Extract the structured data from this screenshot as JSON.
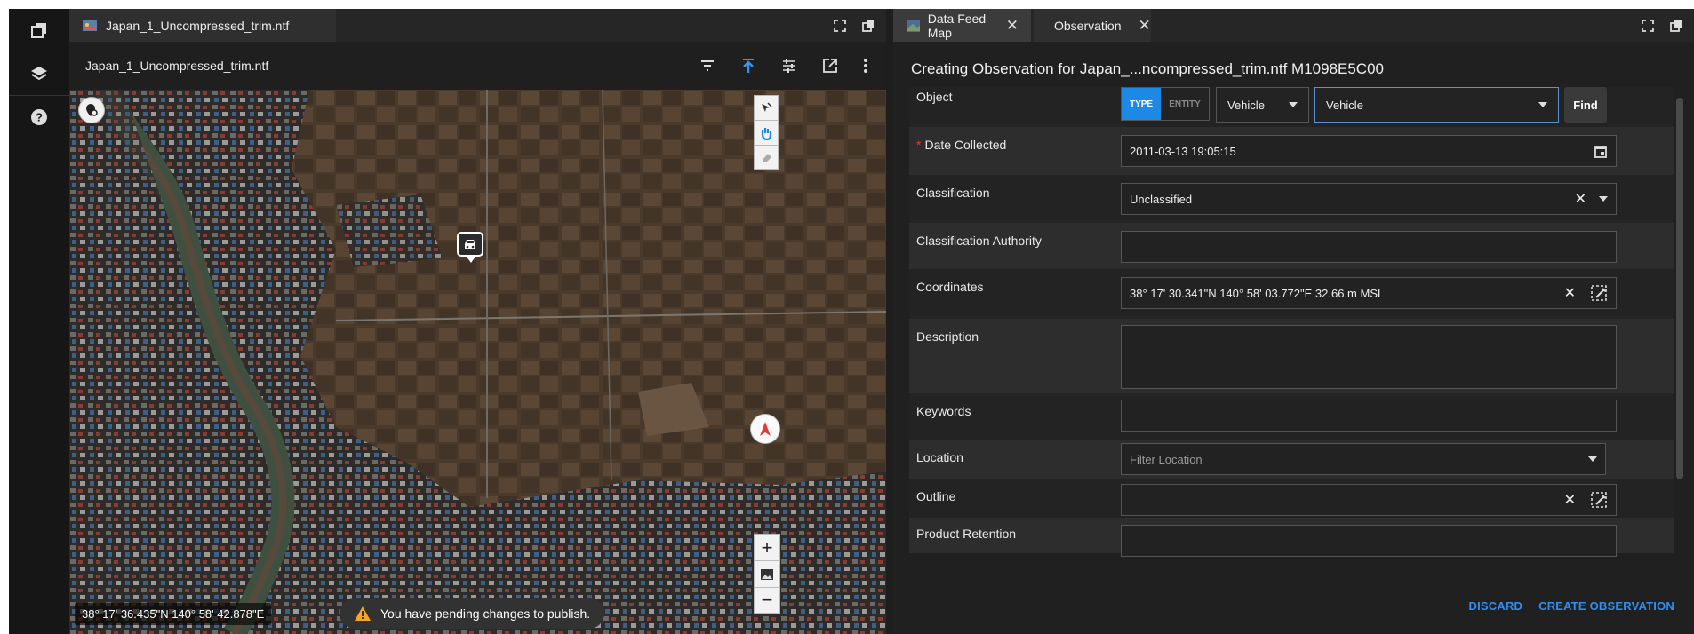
{
  "left_tab": {
    "title": "Japan_1_Uncompressed_trim.ntf"
  },
  "image_header": {
    "title": "Japan_1_Uncompressed_trim.ntf"
  },
  "map": {
    "coordinates": "38° 17' 36.435\"N 140° 58' 42.878\"E",
    "toast": "You have pending changes to publish.",
    "zoom_in": "+",
    "zoom_out": "−"
  },
  "right_tabs": [
    {
      "label": "Data Feed Map"
    },
    {
      "label": "Observation"
    }
  ],
  "form": {
    "title": "Creating Observation for Japan_...ncompressed_trim.ntf M1098E5C00",
    "object": {
      "label": "Object",
      "toggle_type": "TYPE",
      "toggle_entity": "ENTITY",
      "select1": "Vehicle",
      "select2": "Vehicle",
      "find": "Find"
    },
    "date": {
      "label": "Date Collected",
      "required_mark": "*",
      "value": "2011-03-13 19:05:15"
    },
    "classification": {
      "label": "Classification",
      "value": "Unclassified"
    },
    "authority": {
      "label": "Classification Authority",
      "value": ""
    },
    "coordinates": {
      "label": "Coordinates",
      "value": "38° 17' 30.341\"N 140° 58' 03.772\"E 32.66 m MSL"
    },
    "description": {
      "label": "Description",
      "value": ""
    },
    "keywords": {
      "label": "Keywords",
      "value": ""
    },
    "location": {
      "label": "Location",
      "placeholder": "Filter Location"
    },
    "outline": {
      "label": "Outline",
      "value": ""
    },
    "retention": {
      "label": "Product Retention"
    }
  },
  "footer": {
    "discard": "DISCARD",
    "create": "CREATE OBSERVATION"
  },
  "colors": {
    "accent": "#1e88e5",
    "link": "#2f8ff0",
    "required": "#e53935"
  }
}
